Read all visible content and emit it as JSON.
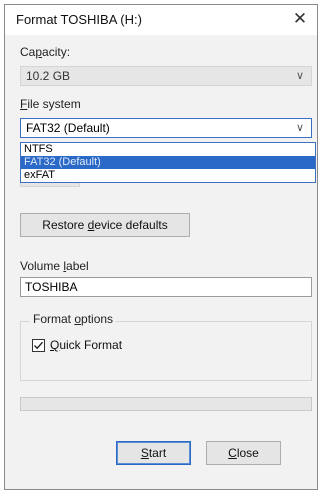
{
  "window": {
    "title": "Format TOSHIBA (H:)",
    "close_glyph": "✕"
  },
  "capacity": {
    "label_prefix": "Ca",
    "label_accel": "p",
    "label_suffix": "acity:",
    "value": "10.2 GB"
  },
  "file_system": {
    "label_accel": "F",
    "label_suffix": "ile system",
    "value": "FAT32 (Default)",
    "options": [
      "NTFS",
      "FAT32 (Default)",
      "exFAT"
    ],
    "selected_index": 1
  },
  "restore_button": {
    "label_prefix": "Restore ",
    "label_accel": "d",
    "label_suffix": "evice defaults"
  },
  "volume_label": {
    "label_prefix": "Volume ",
    "label_accel": "l",
    "label_suffix": "abel",
    "value": "TOSHIBA"
  },
  "format_options": {
    "title_prefix": "Format ",
    "title_accel": "o",
    "title_suffix": "ptions",
    "quick_format": {
      "checked": true,
      "label_accel": "Q",
      "label_suffix": "uick Format"
    }
  },
  "progress": {
    "value": 0
  },
  "footer": {
    "start_accel": "S",
    "start_suffix": "tart",
    "close_accel": "C",
    "close_suffix": "lose"
  },
  "icons": {
    "chevron": "chevron-down-icon",
    "checkmark": "checkmark-icon",
    "close": "close-icon"
  },
  "colors": {
    "selection": "#2a69c7",
    "focus_border": "#3b6fbf",
    "dialog_bg": "#f2f2f2"
  }
}
